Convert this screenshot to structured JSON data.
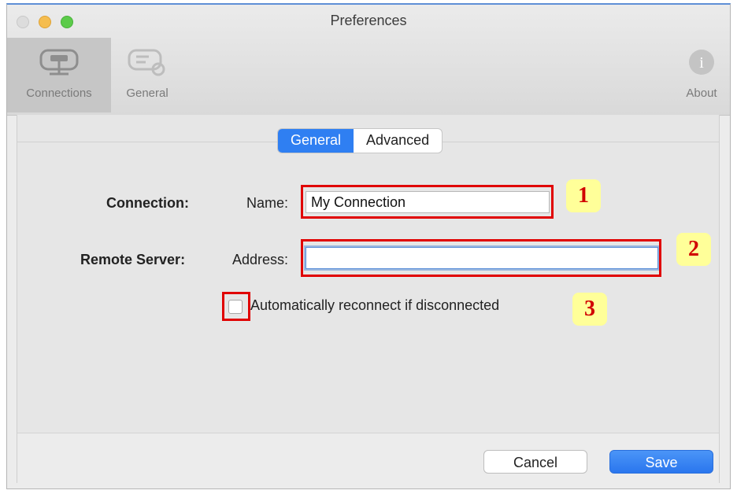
{
  "window": {
    "title": "Preferences"
  },
  "toolbar": {
    "items": [
      {
        "label": "Connections",
        "icon": "connections-icon",
        "selected": true
      },
      {
        "label": "General",
        "icon": "general-settings-icon",
        "selected": false
      },
      {
        "label": "About",
        "icon": "info-icon",
        "selected": false
      }
    ]
  },
  "tabs": [
    {
      "label": "General",
      "selected": true
    },
    {
      "label": "Advanced",
      "selected": false
    }
  ],
  "form": {
    "connection_label": "Connection:",
    "name_label": "Name:",
    "name_value": "My Connection",
    "remote_label": "Remote Server:",
    "address_label": "Address:",
    "address_value": "",
    "reconnect_label": "Automatically reconnect if disconnected",
    "reconnect_checked": false
  },
  "annotations": [
    "1",
    "2",
    "3"
  ],
  "buttons": {
    "cancel": "Cancel",
    "save": "Save"
  },
  "colors": {
    "accent": "#2f7ff2",
    "highlight": "#e00000",
    "callout_bg": "#ffff99"
  }
}
